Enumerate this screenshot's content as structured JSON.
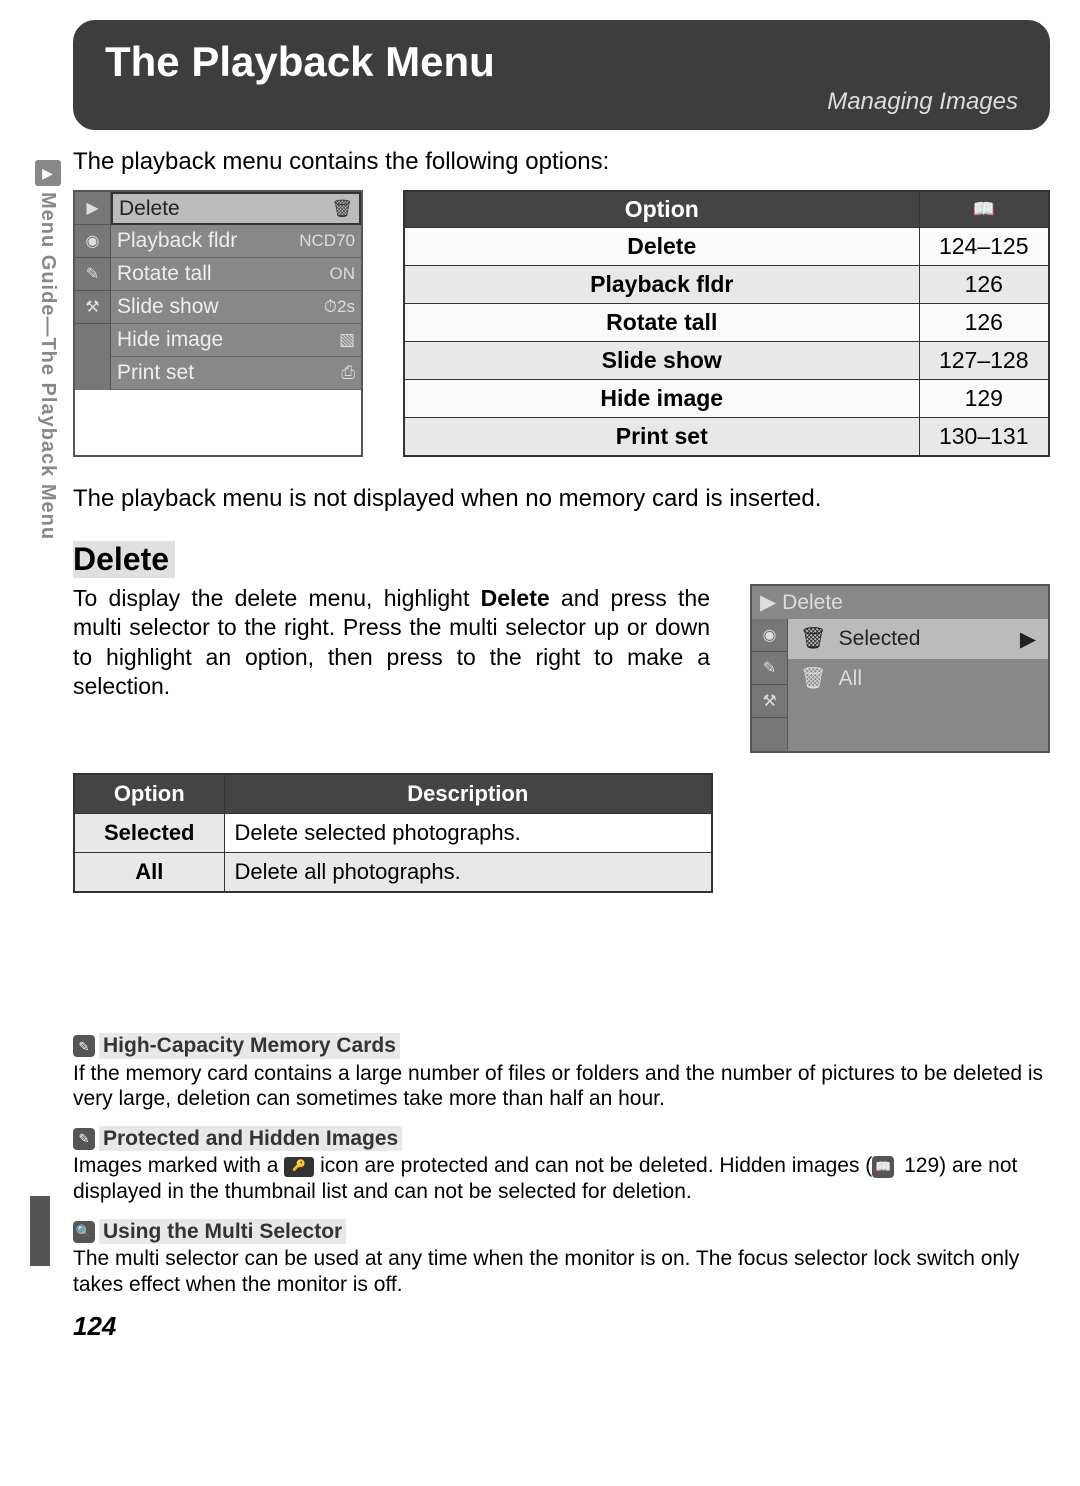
{
  "header": {
    "main_title": "The Playback Menu",
    "sub_title": "Managing Images"
  },
  "side": {
    "label": "Menu Guide—The Playback Menu",
    "icon": "▶"
  },
  "intro": "The playback menu contains the following options:",
  "menu_pane": {
    "icons": [
      "▶",
      "◉",
      "✎",
      "⚒"
    ],
    "items": [
      {
        "label": "Delete",
        "value": "🗑"
      },
      {
        "label": "Playback fldr",
        "value": "NCD70"
      },
      {
        "label": "Rotate tall",
        "value": "ON"
      },
      {
        "label": "Slide show",
        "value": "⏱2s"
      },
      {
        "label": "Hide image",
        "value": "▧"
      },
      {
        "label": "Print set",
        "value": "⎙"
      }
    ],
    "selected_index": 0
  },
  "options_table": {
    "head_option": "Option",
    "head_page_icon": "📖",
    "rows": [
      {
        "name": "Delete",
        "pages": "124–125"
      },
      {
        "name": "Playback fldr",
        "pages": "126"
      },
      {
        "name": "Rotate tall",
        "pages": "126"
      },
      {
        "name": "Slide show",
        "pages": "127–128"
      },
      {
        "name": "Hide image",
        "pages": "129"
      },
      {
        "name": "Print set",
        "pages": "130–131"
      }
    ]
  },
  "note": "The playback menu is not displayed when no memory card is inserted.",
  "delete_section": {
    "heading": "Delete",
    "text_before_bold": "To display the delete menu, highlight ",
    "bold_word": "Delete",
    "text_after_bold": " and press the multi selector to the right.  Press the multi selector up or down to highlight an option, then press to the right to make a selection.",
    "pane_title": "Delete",
    "pane_icons": [
      "▶",
      "◉",
      "✎",
      "⚒"
    ],
    "pane_items": [
      {
        "icon": "🗑",
        "label": "Selected",
        "selected": true
      },
      {
        "icon": "🗑",
        "label": "All",
        "selected": false
      }
    ]
  },
  "desc_table": {
    "head_option": "Option",
    "head_desc": "Description",
    "rows": [
      {
        "opt": "Selected",
        "desc": "Delete selected photographs."
      },
      {
        "opt": "All",
        "desc": "Delete all photographs."
      }
    ]
  },
  "footnotes": [
    {
      "icon": "✎",
      "title": "High-Capacity Memory Cards",
      "body": "If the memory card contains a large number of files or folders and the number of pictures to be deleted is very large, deletion can sometimes take more than half an hour."
    },
    {
      "icon": "✎",
      "title": "Protected and Hidden Images",
      "body_parts": {
        "p1": "Images marked with a ",
        "inline_icon": "🔑",
        "p2": " icon are protected and can not be deleted.  Hidden images (",
        "ref_icon": "📖",
        "ref_page": " 129",
        "p3": ") are not displayed in the thumbnail list and can not be selected for deletion."
      }
    },
    {
      "icon": "🔍",
      "title": "Using the Multi Selector",
      "body": "The multi selector can be used at any time when the monitor is on.  The focus selector lock switch only takes effect when the monitor is off."
    }
  ],
  "page_number": "124"
}
